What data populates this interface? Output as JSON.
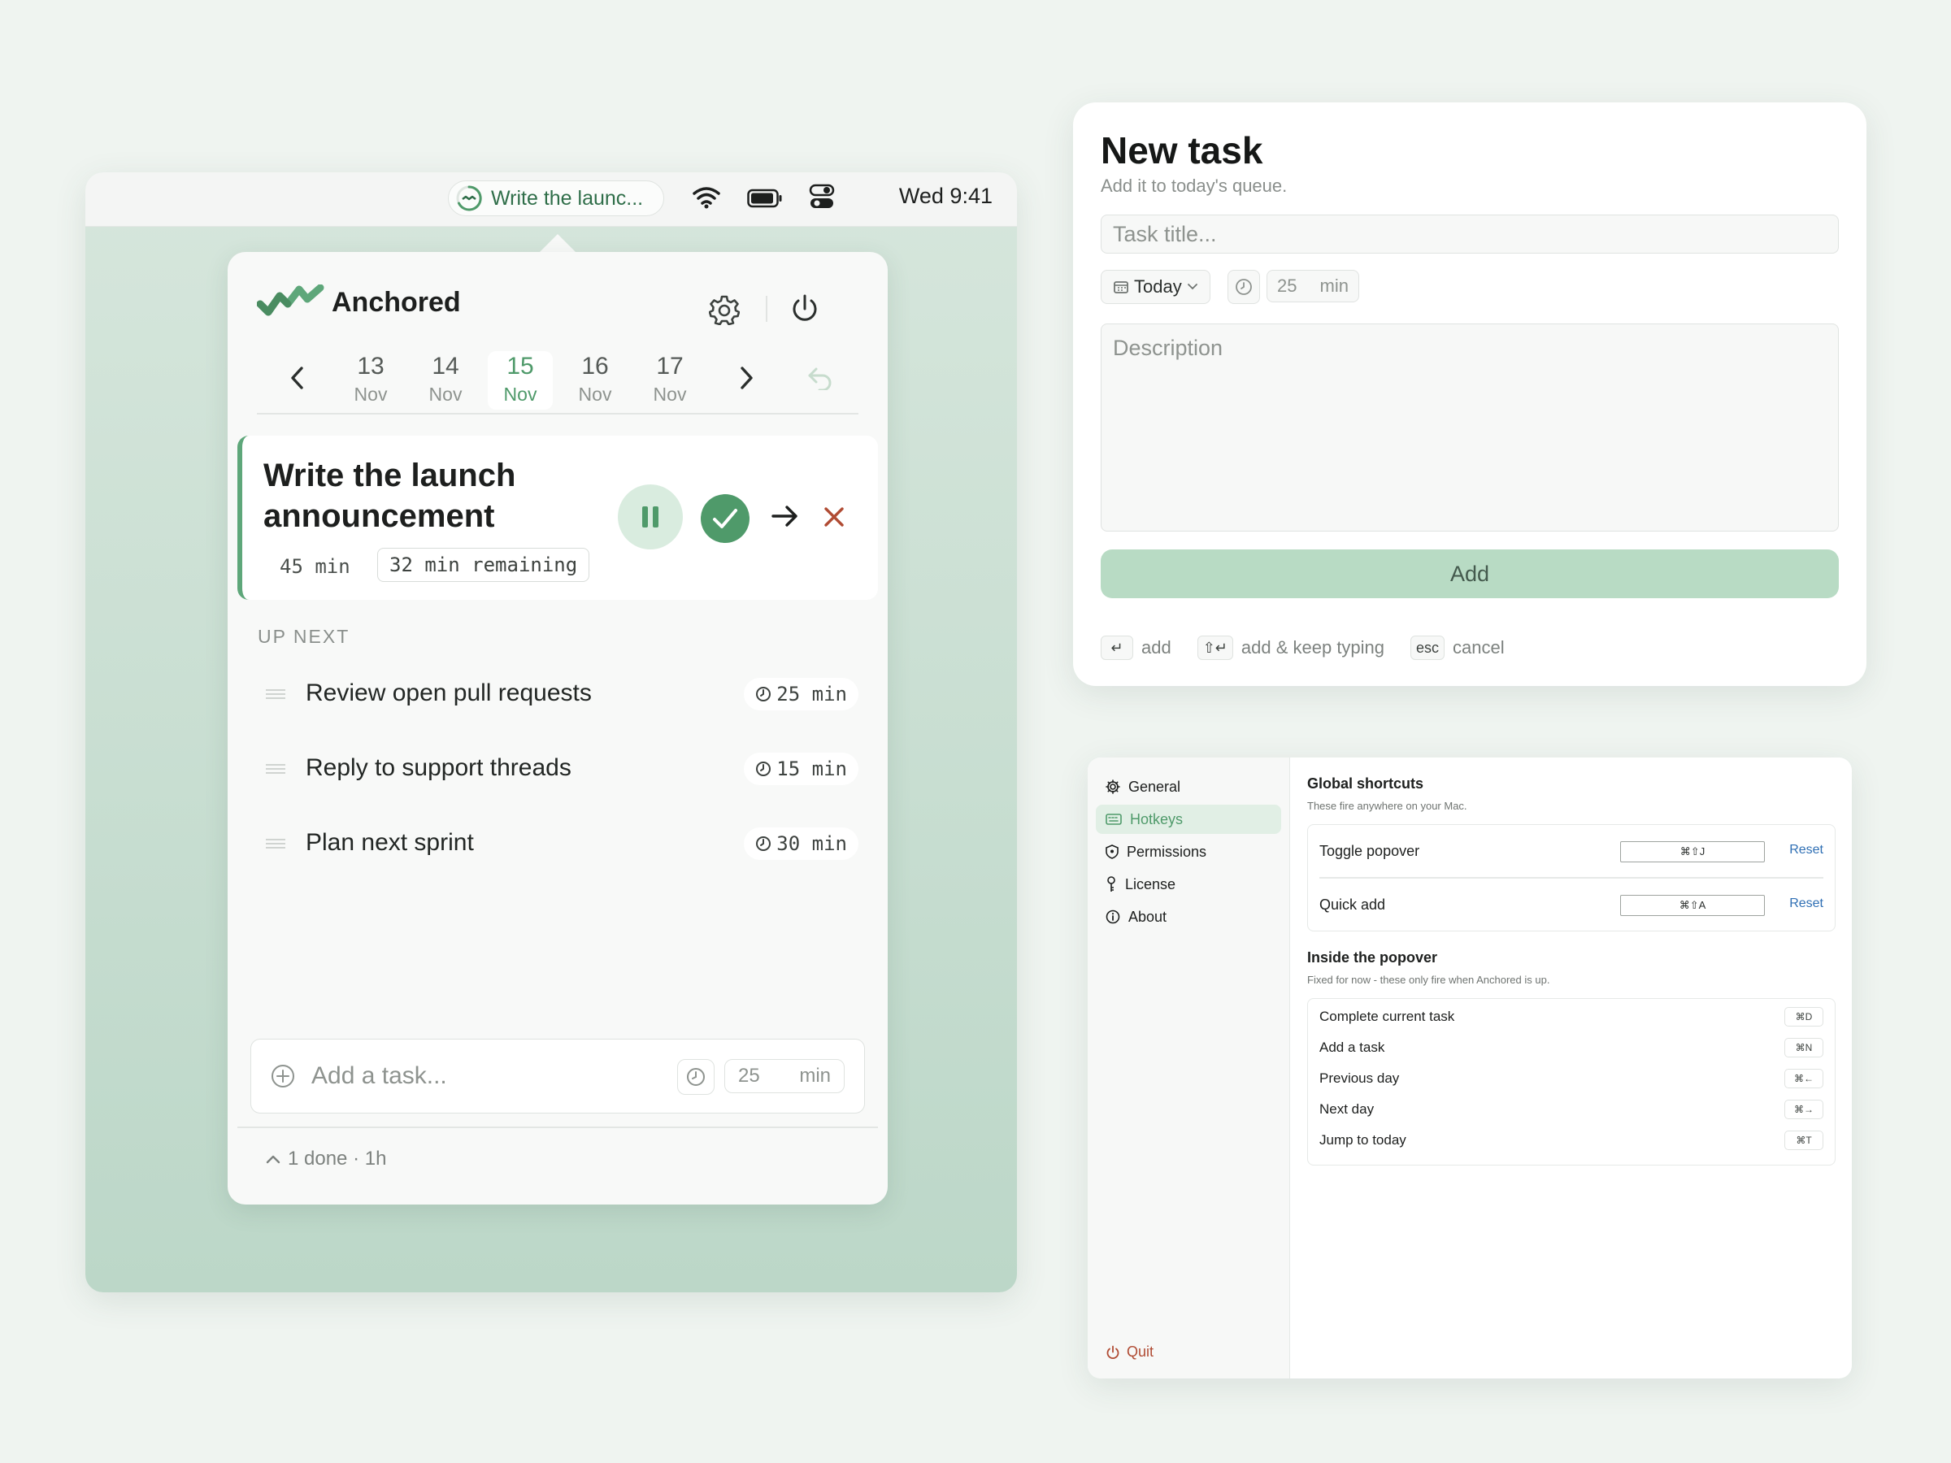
{
  "menubar": {
    "task_label": "Write the launc...",
    "clock": "Wed 9:41"
  },
  "popover": {
    "app_name": "Anchored",
    "dates": [
      {
        "day": "13",
        "month": "Nov"
      },
      {
        "day": "14",
        "month": "Nov"
      },
      {
        "day": "15",
        "month": "Nov",
        "selected": true
      },
      {
        "day": "16",
        "month": "Nov"
      },
      {
        "day": "17",
        "month": "Nov"
      }
    ],
    "current_task": {
      "title": "Write the launch announcement",
      "estimate": "45 min",
      "remaining": "32 min remaining"
    },
    "up_next_label": "UP NEXT",
    "queue": [
      {
        "title": "Review open pull requests",
        "duration": "25 min"
      },
      {
        "title": "Reply to support threads",
        "duration": "15 min"
      },
      {
        "title": "Plan next sprint",
        "duration": "30 min"
      }
    ],
    "add_task": {
      "placeholder": "Add a task...",
      "duration": "25",
      "unit": "min"
    },
    "done_summary": "1 done · 1h"
  },
  "new_task": {
    "title": "New task",
    "subtitle": "Add it to today's queue.",
    "title_placeholder": "Task title...",
    "date_label": "Today",
    "duration": "25",
    "unit": "min",
    "description_placeholder": "Description",
    "add_label": "Add",
    "hints": [
      {
        "key": "↵",
        "label": "add"
      },
      {
        "key": "⇧↵",
        "label": "add & keep typing"
      },
      {
        "key": "esc",
        "label": "cancel"
      }
    ]
  },
  "settings": {
    "sidebar": [
      {
        "label": "General",
        "icon": "gear-icon"
      },
      {
        "label": "Hotkeys",
        "icon": "keyboard-icon",
        "selected": true
      },
      {
        "label": "Permissions",
        "icon": "shield-icon"
      },
      {
        "label": "License",
        "icon": "key-icon"
      },
      {
        "label": "About",
        "icon": "info-icon"
      }
    ],
    "quit_label": "Quit",
    "global": {
      "heading": "Global shortcuts",
      "sub": "These fire anywhere on your Mac.",
      "rows": [
        {
          "label": "Toggle popover",
          "shortcut": "⌘⇧J",
          "reset": "Reset"
        },
        {
          "label": "Quick add",
          "shortcut": "⌘⇧A",
          "reset": "Reset"
        }
      ]
    },
    "inside": {
      "heading": "Inside the popover",
      "sub": "Fixed for now - these only fire when Anchored is up.",
      "rows": [
        {
          "label": "Complete current task",
          "key": "⌘D"
        },
        {
          "label": "Add a task",
          "key": "⌘N"
        },
        {
          "label": "Previous day",
          "key": "⌘←"
        },
        {
          "label": "Next day",
          "key": "⌘→"
        },
        {
          "label": "Jump to today",
          "key": "⌘T"
        }
      ]
    }
  },
  "colors": {
    "accent": "#4f9a6a",
    "accent_light": "#d9ecdf",
    "danger": "#b04b33",
    "link": "#2f6fb4"
  }
}
